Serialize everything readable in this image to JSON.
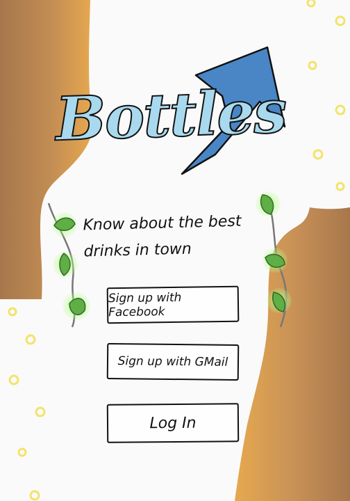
{
  "app": {
    "name": "Bottles",
    "tagline": "Know about the best drinks in town"
  },
  "buttons": {
    "facebook": "Sign up with Facebook",
    "gmail": "Sign up with GMail",
    "login": "Log In"
  },
  "colors": {
    "background": "#fafafa",
    "title_fill": "#a9d9ee",
    "arrow": "#4a86c6",
    "bottle_light": "#e6a84f",
    "bottle_dark": "#a7774c",
    "leaf": "#5fae46",
    "bubble": "#f6ec8a"
  },
  "icons": {
    "arrow": "up-right-arrow-icon",
    "vine": "leaf-vine-icon",
    "bubbles": "bubble-icon"
  }
}
